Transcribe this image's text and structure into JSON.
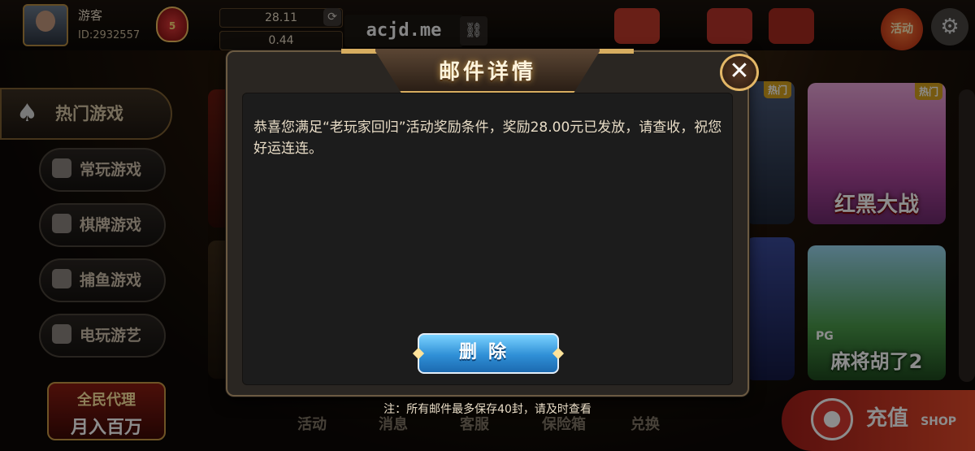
{
  "user": {
    "nickname": "游客",
    "id_label": "ID:2932557",
    "vip_level": "5"
  },
  "wallet": {
    "balance": "28.11",
    "bank": "0.44"
  },
  "site": {
    "domain": "acjd.me"
  },
  "top_icons": [
    "活动",
    "设置"
  ],
  "sidebar": {
    "hot": "热门游戏",
    "items": [
      {
        "label": "常玩游戏"
      },
      {
        "label": "棋牌游戏"
      },
      {
        "label": "捕鱼游戏"
      },
      {
        "label": "电玩游艺"
      }
    ],
    "agent_line1": "全民代理",
    "agent_line2": "月入百万"
  },
  "cards": {
    "hot_tag": "热门",
    "card1_name": "红黑大战",
    "card2_name": "麻将胡了2",
    "card2_provider": "PG"
  },
  "bottom_nav": [
    "活动",
    "消息",
    "客服",
    "保险箱",
    "兑换"
  ],
  "recharge": {
    "label": "充值",
    "sub": "SHOP"
  },
  "modal": {
    "title": "邮件详情",
    "message": "恭喜您满足“老玩家回归”活动奖励条件，奖励28.00元已发放，请查收，祝您好运连连。",
    "delete_label": "删除",
    "close_glyph": "✕",
    "note": "注：所有邮件最多保存40封，请及时查看"
  }
}
